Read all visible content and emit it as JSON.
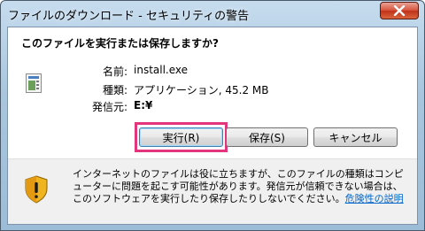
{
  "window": {
    "title": "ファイルのダウンロード - セキュリティの警告"
  },
  "dialog": {
    "question": "このファイルを実行または保存しますか?",
    "file": {
      "icon": "application-file-icon",
      "name_label": "名前:",
      "name_value": "install.exe",
      "type_label": "種類:",
      "type_value": "アプリケーション, 45.2 MB",
      "source_label": "発信元:",
      "source_value": "E:¥"
    },
    "buttons": {
      "run": "実行(R)",
      "save": "保存(S)",
      "cancel": "キャンセル"
    },
    "warning": {
      "icon": "security-shield-icon",
      "text": "インターネットのファイルは役に立ちますが、このファイルの種類はコンピューターに問題を起こす可能性があります。発信元が信頼できない場合は、このソフトウェアを実行したり保存したりしないでください。",
      "link": "危険性の説明"
    }
  },
  "colors": {
    "highlight": "#e2357b",
    "link": "#0066cc"
  }
}
